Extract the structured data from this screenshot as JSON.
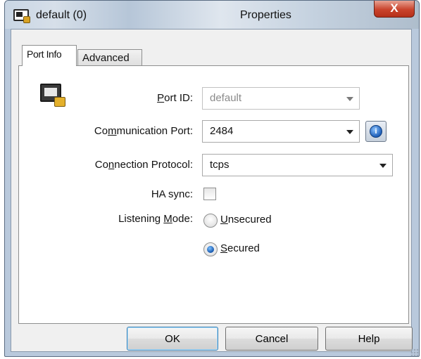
{
  "window": {
    "title": "default (0)",
    "title_suffix": "Properties",
    "close_label": "X"
  },
  "tabs": [
    {
      "label": "Port Info",
      "active": true
    },
    {
      "label": "Advanced",
      "active": false
    }
  ],
  "form": {
    "port_id": {
      "label_prefix": "",
      "label_mnemonic": "P",
      "label_rest": "ort ID:",
      "value": "default",
      "disabled": true
    },
    "communication_port": {
      "label_prefix": "Co",
      "label_mnemonic": "m",
      "label_rest": "munication Port:",
      "value": "2484"
    },
    "connection_protocol": {
      "label_prefix": "Co",
      "label_mnemonic": "n",
      "label_rest": "nection Protocol:",
      "value": "tcps"
    },
    "ha_sync": {
      "label": "HA sync:",
      "checked": false
    },
    "listening_mode": {
      "label_prefix": "Listening ",
      "label_mnemonic": "M",
      "label_rest": "ode:",
      "options": [
        {
          "mnemonic": "U",
          "rest": "nsecured",
          "checked": false
        },
        {
          "mnemonic": "S",
          "rest": "ecured",
          "checked": true
        }
      ]
    }
  },
  "buttons": {
    "ok": "OK",
    "cancel": "Cancel",
    "help": "Help"
  },
  "icons": {
    "title": "port-lock-icon",
    "port": "network-port-lock-icon",
    "info": "info-icon"
  },
  "colors": {
    "title_bar": "#c4d1df",
    "close_button": "#c9432c",
    "radio_selected": "#0e4fa6"
  }
}
